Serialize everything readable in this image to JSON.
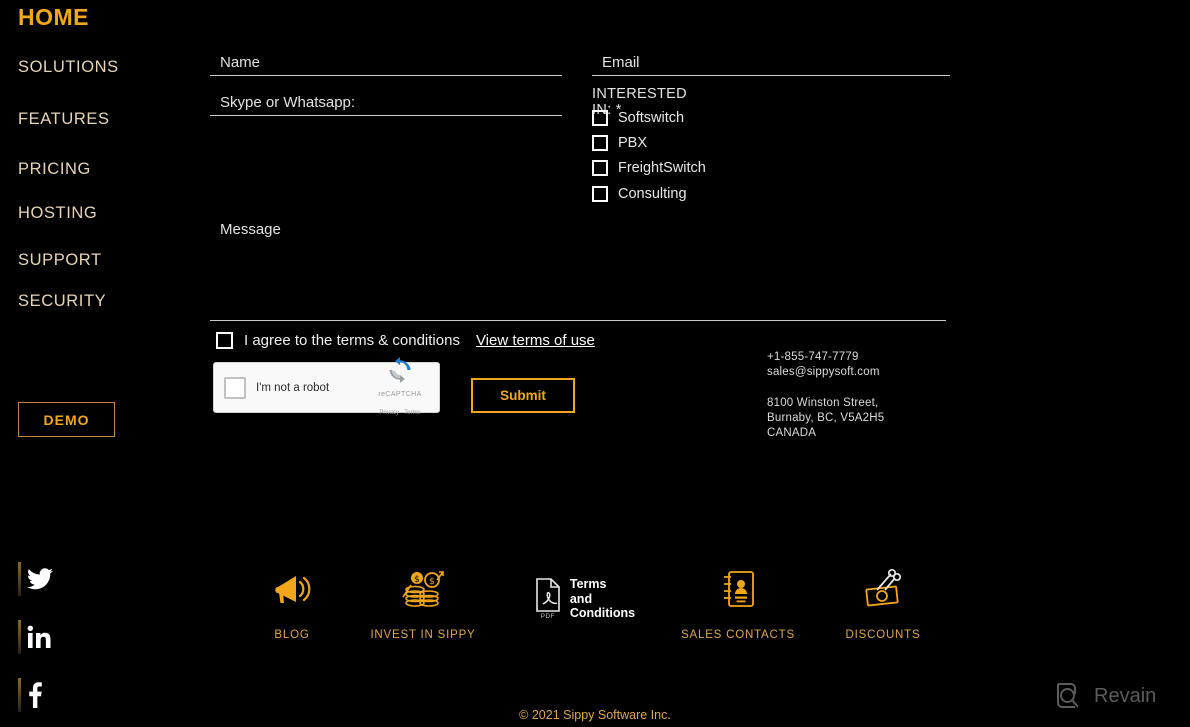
{
  "sidebar": {
    "home_label": "HOME",
    "items": [
      {
        "label": "SOLUTIONS"
      },
      {
        "label": "FEATURES"
      },
      {
        "label": "PRICING"
      },
      {
        "label": "HOSTING"
      },
      {
        "label": "SUPPORT"
      },
      {
        "label": "SECURITY"
      }
    ],
    "demo_label": "DEMO"
  },
  "form": {
    "name_placeholder": "Name",
    "skype_placeholder": "Skype or Whatsapp:",
    "email_placeholder": "Email",
    "message_placeholder": "Message",
    "interested_label": "INTERESTED IN: *",
    "interests": [
      {
        "label": "Softswitch"
      },
      {
        "label": "PBX"
      },
      {
        "label": "FreightSwitch"
      },
      {
        "label": "Consulting"
      }
    ],
    "agree_text": "I agree to the terms & conditions",
    "agree_link": "View terms of use",
    "submit_label": "Submit",
    "recaptcha": {
      "label": "I'm not a robot",
      "brand": "reCAPTCHA",
      "terms": "Privacy - Terms"
    }
  },
  "contact": {
    "phone": "+1-855-747-7779",
    "email": "sales@sippysoft.com",
    "address_line1": "8100 Winston Street,",
    "address_line2": "Burnaby, BC, V5A2H5",
    "address_line3": "CANADA"
  },
  "social": [
    {
      "name": "twitter"
    },
    {
      "name": "linkedin"
    },
    {
      "name": "facebook"
    }
  ],
  "footer_links": [
    {
      "label": "BLOG",
      "icon": "megaphone-icon"
    },
    {
      "label": "INVEST IN SIPPY",
      "icon": "money-coins-icon"
    },
    {
      "label": "",
      "icon": "pdf-icon",
      "pdf_caption": "PDF",
      "text_line1": "Terms",
      "text_line2": "and",
      "text_line3": "Conditions"
    },
    {
      "label": "SALES CONTACTS",
      "icon": "address-book-icon"
    },
    {
      "label": "DISCOUNTS",
      "icon": "coupon-scissors-icon"
    }
  ],
  "copyright": "© 2021 Sippy Software Inc.",
  "watermark": {
    "label": "Revain",
    "icon": "revain-logo-icon"
  },
  "colors": {
    "accent": "#f2a71b",
    "nav_text": "#e8d5b8",
    "background": "#000000",
    "field_rule": "#c9c9c9"
  }
}
